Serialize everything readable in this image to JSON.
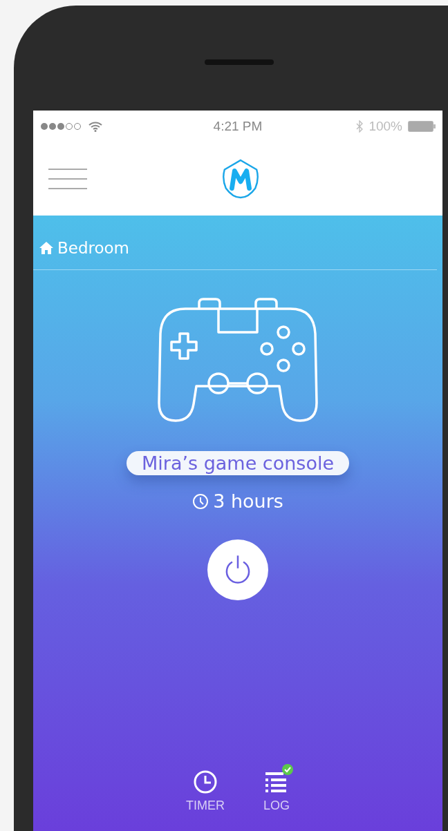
{
  "status_bar": {
    "time": "4:21 PM",
    "battery": "100%"
  },
  "room": {
    "label": "Bedroom"
  },
  "device": {
    "name": "Mira’s game console",
    "timer": "3 hours"
  },
  "bottom_bar": [
    {
      "kind": "timer",
      "label": "TIMER",
      "completed": false
    },
    {
      "kind": "log",
      "label": "LOG",
      "completed": true
    }
  ]
}
